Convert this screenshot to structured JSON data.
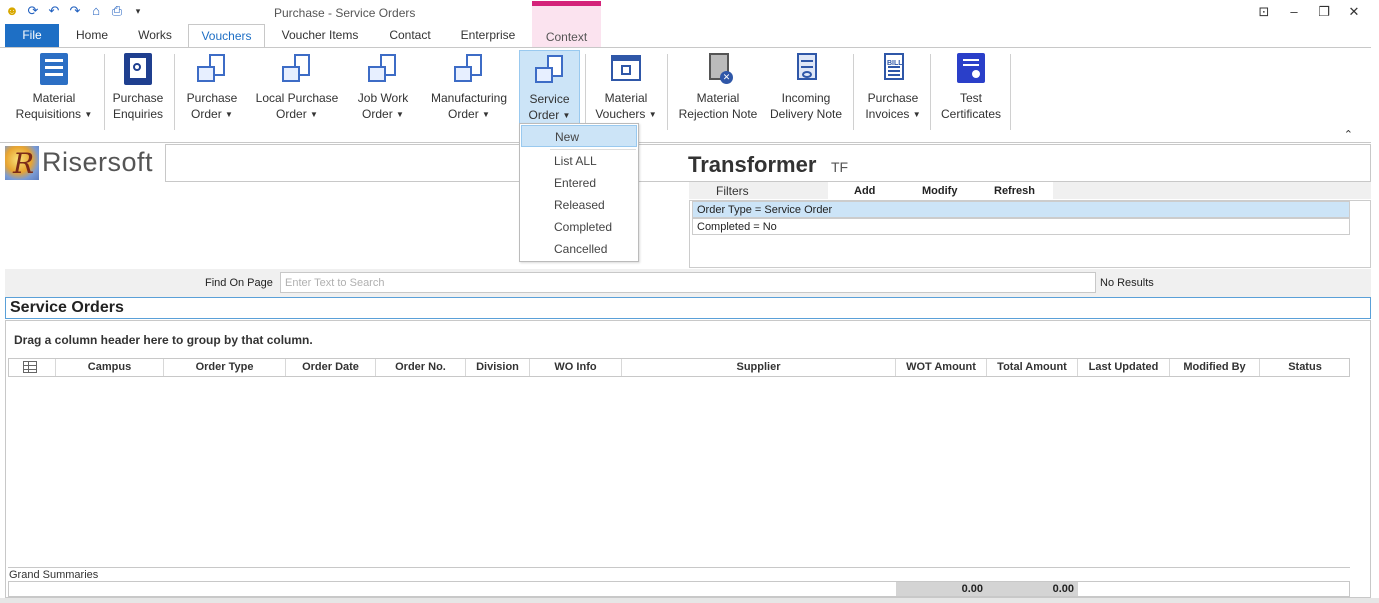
{
  "window": {
    "title": "Purchase - Service Orders"
  },
  "tabs": [
    {
      "label": "File"
    },
    {
      "label": "Home"
    },
    {
      "label": "Works"
    },
    {
      "label": "Vouchers"
    },
    {
      "label": "Voucher Items"
    },
    {
      "label": "Contact"
    },
    {
      "label": "Enterprise"
    },
    {
      "label": "Context"
    }
  ],
  "ribbon": [
    {
      "line1": "Material",
      "line2": "Requisitions"
    },
    {
      "line1": "Purchase",
      "line2": "Enquiries"
    },
    {
      "line1": "Purchase",
      "line2": "Order"
    },
    {
      "line1": "Local Purchase",
      "line2": "Order"
    },
    {
      "line1": "Job Work",
      "line2": "Order"
    },
    {
      "line1": "Manufacturing",
      "line2": "Order"
    },
    {
      "line1": "Service",
      "line2": "Order"
    },
    {
      "line1": "Material",
      "line2": "Vouchers"
    },
    {
      "line1": "Material",
      "line2": "Rejection Note"
    },
    {
      "line1": "Incoming",
      "line2": "Delivery Note"
    },
    {
      "line1": "Purchase",
      "line2": "Invoices"
    },
    {
      "line1": "Test",
      "line2": "Certificates"
    }
  ],
  "dropdown": [
    "New",
    "List ALL",
    "Entered",
    "Released",
    "Completed",
    "Cancelled"
  ],
  "logo": {
    "mark": "R",
    "text": "Risersoft"
  },
  "company": {
    "name": "Transformer",
    "code": "TF"
  },
  "filters": {
    "label": "Filters",
    "add": "Add",
    "modify": "Modify",
    "refresh": "Refresh",
    "rows": [
      "Order Type = Service Order",
      "Completed = No"
    ]
  },
  "find": {
    "label": "Find On Page",
    "placeholder": "Enter Text to Search",
    "result": "No Results"
  },
  "section": {
    "title": "Service Orders",
    "group_hint": "Drag a column header here to group by that column."
  },
  "grid": {
    "columns": [
      "Campus",
      "Order Type",
      "Order Date",
      "Order No.",
      "Division",
      "WO Info",
      "Supplier",
      "WOT Amount",
      "Total Amount",
      "Last Updated",
      "Modified By",
      "Status"
    ]
  },
  "summaries": {
    "label": "Grand Summaries",
    "wot_amount": "0.00",
    "total_amount": "0.00"
  },
  "icons": [
    "app-icon",
    "refresh-icon",
    "undo-icon",
    "redo-icon",
    "home-icon",
    "print-icon",
    "qat-dropdown-icon"
  ],
  "colors": {
    "file_tab": "#1e6fc5",
    "context_accent": "#d4237a",
    "highlight": "#cce4f7"
  }
}
